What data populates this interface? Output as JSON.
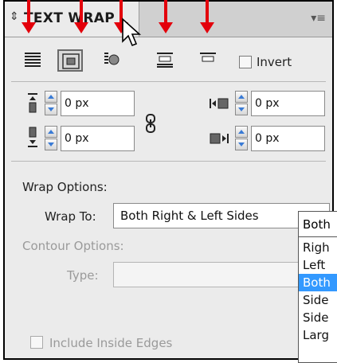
{
  "panel": {
    "title": "TEXT WRAP",
    "collapse_glyph": "⇕",
    "menu_glyph": "▾≡"
  },
  "wrap_buttons": [
    {
      "name": "no-text-wrap",
      "active": false
    },
    {
      "name": "wrap-around-bounding-box",
      "active": true
    },
    {
      "name": "wrap-around-object-shape",
      "active": false
    },
    {
      "name": "jump-object",
      "active": false
    },
    {
      "name": "jump-to-next-column",
      "active": false
    }
  ],
  "invert": {
    "label": "Invert",
    "checked": false
  },
  "offsets": {
    "top": "0 px",
    "bottom": "0 px",
    "left": "0 px",
    "right": "0 px"
  },
  "wrap_options": {
    "heading": "Wrap Options:",
    "wrap_to_label": "Wrap To:",
    "wrap_to_value": "Both Right & Left Sides"
  },
  "contour_options": {
    "heading": "Contour Options:",
    "type_label": "Type:",
    "type_value": ""
  },
  "include_inside_edges": {
    "label": "Include Inside Edges",
    "checked": false
  },
  "dropdown": {
    "current": "Both",
    "options": [
      "Righ",
      "Left",
      "Both",
      "Side",
      "Side",
      "Larg"
    ],
    "selected_index": 2
  },
  "colors": {
    "annotation_arrow": "#e3000b",
    "selection": "#3399ff"
  }
}
